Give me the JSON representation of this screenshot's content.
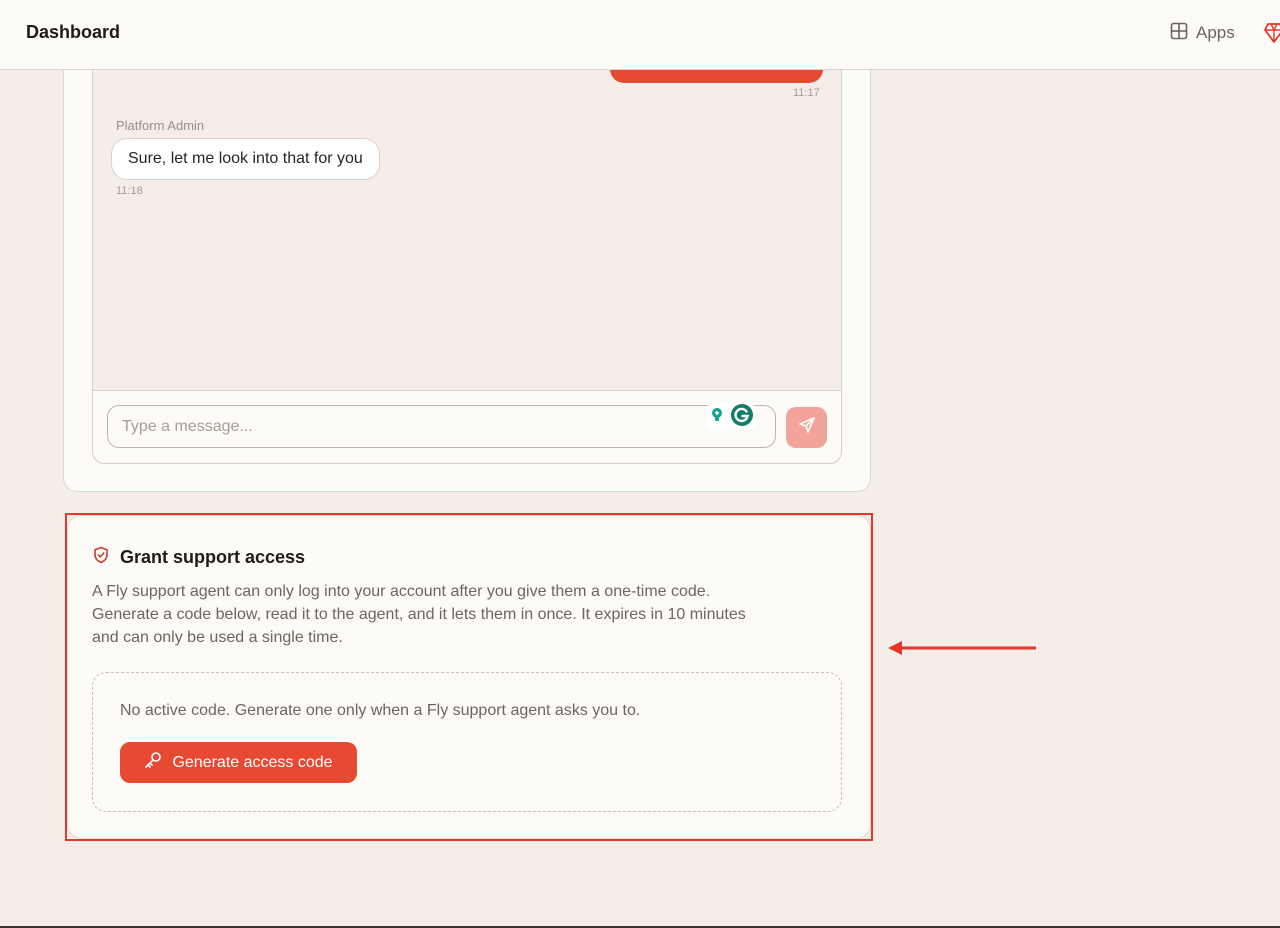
{
  "header": {
    "title": "Dashboard",
    "apps_label": "Apps"
  },
  "chat": {
    "user_message_time": "11:17",
    "admin_sender": "Platform Admin",
    "admin_message": "Sure, let me look into that for you",
    "admin_message_time": "11:18",
    "input_placeholder": "Type a message..."
  },
  "grant": {
    "title": "Grant support access",
    "description": "A Fly support agent can only log into your account after you give them a one-time code. Generate a code below, read it to the agent, and it lets them in once. It expires in 10 minutes and can only be used a single time.",
    "status": "No active code. Generate one only when a Fly support agent asks you to.",
    "button_label": "Generate access code"
  },
  "colors": {
    "accent": "#e64a33",
    "accent_disabled": "#f2a39a",
    "background": "#f5ede7",
    "card": "#fdfbf7",
    "highlight": "#e5372a"
  },
  "icons": {
    "apps": "grid-icon",
    "brand": "gem-icon",
    "grammarly": "grammarly-icon",
    "send": "send-icon",
    "shield": "shield-check-icon",
    "key": "key-icon"
  }
}
